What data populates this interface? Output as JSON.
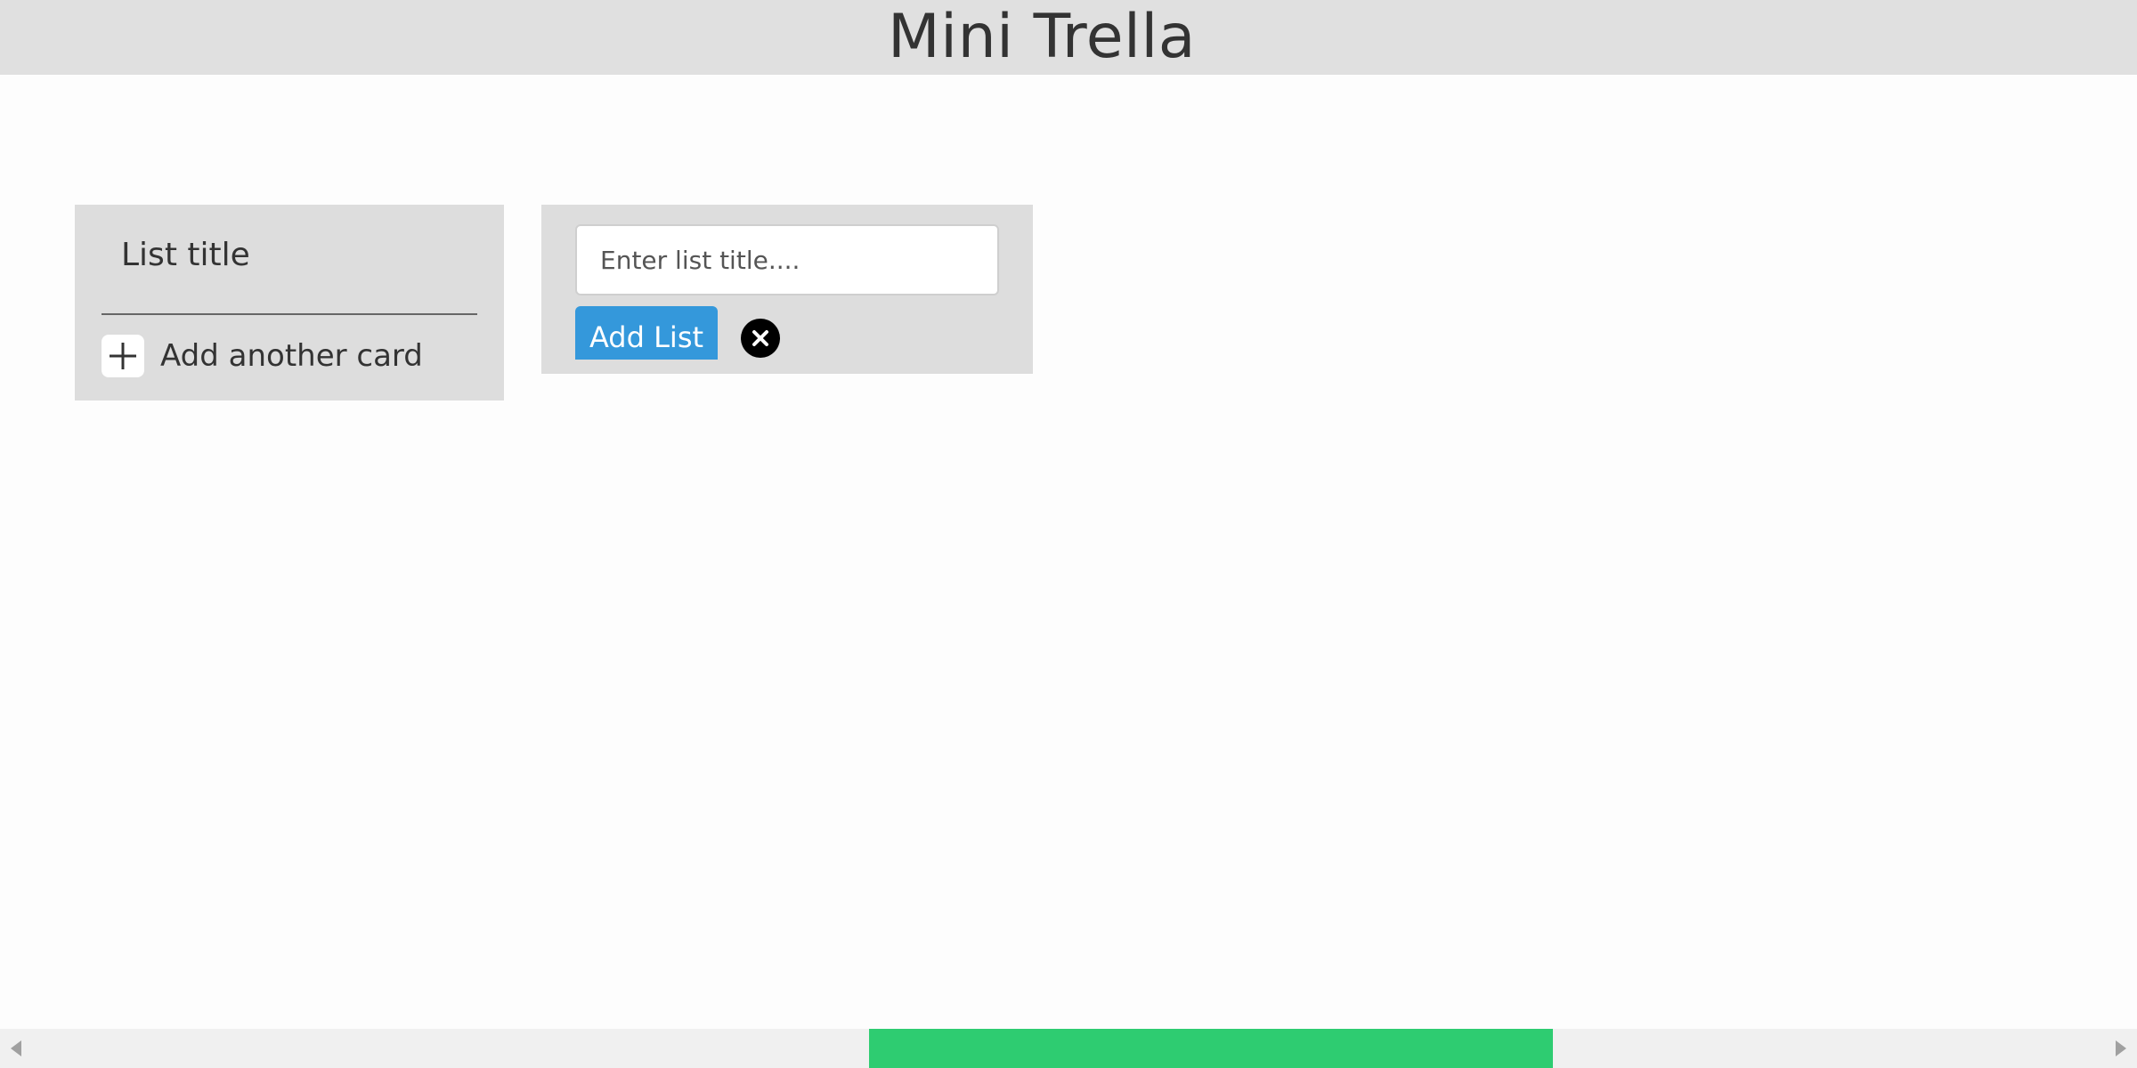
{
  "app": {
    "title": "Mini Trella"
  },
  "board": {
    "lists": [
      {
        "title": "List title",
        "add_card_label": "Add another card"
      }
    ],
    "new_list": {
      "input_value": "",
      "input_placeholder": "Enter list title....",
      "add_button_label": "Add List",
      "close_icon": "close-icon"
    }
  },
  "icons": {
    "add_card": "plus-icon",
    "cancel": "close-icon",
    "scroll_left": "arrow-left-icon",
    "scroll_right": "arrow-right-icon"
  },
  "colors": {
    "header_bg": "#e0e0e0",
    "list_bg": "#dddddd",
    "primary_button": "#3498db",
    "scroll_thumb": "#2ecc71",
    "text": "#333333"
  }
}
